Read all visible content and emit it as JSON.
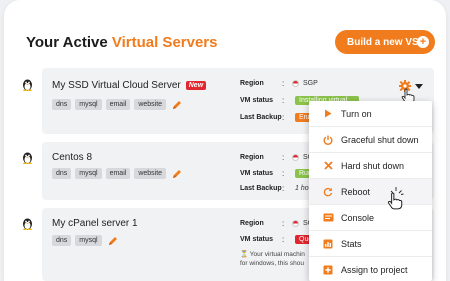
{
  "header": {
    "title_prefix": "Your Active ",
    "title_accent": "Virtual Servers",
    "build_button": "Build a new VS",
    "build_icon": "plus-icon"
  },
  "colors": {
    "accent": "#f07c1e",
    "new_badge": "#e0262f",
    "status_green": "#8bc34a",
    "status_orange": "#f07c1e",
    "status_red": "#e0262f"
  },
  "labels": {
    "region": "Region",
    "vm_status": "VM status",
    "last_backup": "Last Backup",
    "colon": ":"
  },
  "servers": [
    {
      "name": "My SSD Virtual Cloud Server",
      "badge": "New",
      "tags": [
        "dns",
        "mysql",
        "email",
        "website"
      ],
      "region": "SGP",
      "vm_status": "Installing virtual",
      "last_backup": "Enab"
    },
    {
      "name": "Centos 8",
      "tags": [
        "dns",
        "mysql",
        "email",
        "website"
      ],
      "region": "SGP",
      "vm_status": "Runn",
      "last_backup": "1 hou"
    },
    {
      "name": "My cPanel server 1",
      "tags": [
        "dns",
        "mysql"
      ],
      "region": "SGP",
      "vm_status": "Quer",
      "info_line1": "Your virtual machin",
      "info_line2": "for windows, this shou"
    }
  ],
  "menu": {
    "items": [
      {
        "label": "Turn on",
        "icon": "play-icon"
      },
      {
        "label": "Graceful shut down",
        "icon": "power-icon"
      },
      {
        "label": "Hard shut down",
        "icon": "close-icon"
      },
      {
        "label": "Reboot",
        "icon": "refresh-icon"
      },
      {
        "label": "Console",
        "icon": "console-icon"
      },
      {
        "label": "Stats",
        "icon": "stats-icon"
      },
      {
        "label": "Assign to project",
        "icon": "plus-square-icon"
      }
    ],
    "active_index": 3
  }
}
